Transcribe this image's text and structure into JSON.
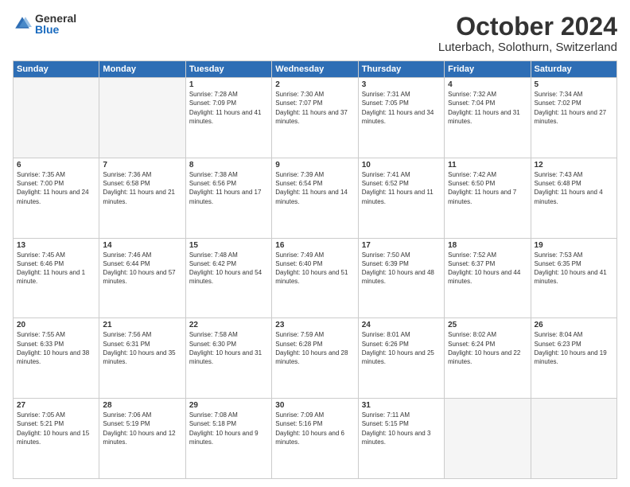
{
  "logo": {
    "general": "General",
    "blue": "Blue"
  },
  "title": "October 2024",
  "location": "Luterbach, Solothurn, Switzerland",
  "headers": [
    "Sunday",
    "Monday",
    "Tuesday",
    "Wednesday",
    "Thursday",
    "Friday",
    "Saturday"
  ],
  "weeks": [
    [
      {
        "day": "",
        "info": ""
      },
      {
        "day": "",
        "info": ""
      },
      {
        "day": "1",
        "sunrise": "Sunrise: 7:28 AM",
        "sunset": "Sunset: 7:09 PM",
        "daylight": "Daylight: 11 hours and 41 minutes."
      },
      {
        "day": "2",
        "sunrise": "Sunrise: 7:30 AM",
        "sunset": "Sunset: 7:07 PM",
        "daylight": "Daylight: 11 hours and 37 minutes."
      },
      {
        "day": "3",
        "sunrise": "Sunrise: 7:31 AM",
        "sunset": "Sunset: 7:05 PM",
        "daylight": "Daylight: 11 hours and 34 minutes."
      },
      {
        "day": "4",
        "sunrise": "Sunrise: 7:32 AM",
        "sunset": "Sunset: 7:04 PM",
        "daylight": "Daylight: 11 hours and 31 minutes."
      },
      {
        "day": "5",
        "sunrise": "Sunrise: 7:34 AM",
        "sunset": "Sunset: 7:02 PM",
        "daylight": "Daylight: 11 hours and 27 minutes."
      }
    ],
    [
      {
        "day": "6",
        "sunrise": "Sunrise: 7:35 AM",
        "sunset": "Sunset: 7:00 PM",
        "daylight": "Daylight: 11 hours and 24 minutes."
      },
      {
        "day": "7",
        "sunrise": "Sunrise: 7:36 AM",
        "sunset": "Sunset: 6:58 PM",
        "daylight": "Daylight: 11 hours and 21 minutes."
      },
      {
        "day": "8",
        "sunrise": "Sunrise: 7:38 AM",
        "sunset": "Sunset: 6:56 PM",
        "daylight": "Daylight: 11 hours and 17 minutes."
      },
      {
        "day": "9",
        "sunrise": "Sunrise: 7:39 AM",
        "sunset": "Sunset: 6:54 PM",
        "daylight": "Daylight: 11 hours and 14 minutes."
      },
      {
        "day": "10",
        "sunrise": "Sunrise: 7:41 AM",
        "sunset": "Sunset: 6:52 PM",
        "daylight": "Daylight: 11 hours and 11 minutes."
      },
      {
        "day": "11",
        "sunrise": "Sunrise: 7:42 AM",
        "sunset": "Sunset: 6:50 PM",
        "daylight": "Daylight: 11 hours and 7 minutes."
      },
      {
        "day": "12",
        "sunrise": "Sunrise: 7:43 AM",
        "sunset": "Sunset: 6:48 PM",
        "daylight": "Daylight: 11 hours and 4 minutes."
      }
    ],
    [
      {
        "day": "13",
        "sunrise": "Sunrise: 7:45 AM",
        "sunset": "Sunset: 6:46 PM",
        "daylight": "Daylight: 11 hours and 1 minute."
      },
      {
        "day": "14",
        "sunrise": "Sunrise: 7:46 AM",
        "sunset": "Sunset: 6:44 PM",
        "daylight": "Daylight: 10 hours and 57 minutes."
      },
      {
        "day": "15",
        "sunrise": "Sunrise: 7:48 AM",
        "sunset": "Sunset: 6:42 PM",
        "daylight": "Daylight: 10 hours and 54 minutes."
      },
      {
        "day": "16",
        "sunrise": "Sunrise: 7:49 AM",
        "sunset": "Sunset: 6:40 PM",
        "daylight": "Daylight: 10 hours and 51 minutes."
      },
      {
        "day": "17",
        "sunrise": "Sunrise: 7:50 AM",
        "sunset": "Sunset: 6:39 PM",
        "daylight": "Daylight: 10 hours and 48 minutes."
      },
      {
        "day": "18",
        "sunrise": "Sunrise: 7:52 AM",
        "sunset": "Sunset: 6:37 PM",
        "daylight": "Daylight: 10 hours and 44 minutes."
      },
      {
        "day": "19",
        "sunrise": "Sunrise: 7:53 AM",
        "sunset": "Sunset: 6:35 PM",
        "daylight": "Daylight: 10 hours and 41 minutes."
      }
    ],
    [
      {
        "day": "20",
        "sunrise": "Sunrise: 7:55 AM",
        "sunset": "Sunset: 6:33 PM",
        "daylight": "Daylight: 10 hours and 38 minutes."
      },
      {
        "day": "21",
        "sunrise": "Sunrise: 7:56 AM",
        "sunset": "Sunset: 6:31 PM",
        "daylight": "Daylight: 10 hours and 35 minutes."
      },
      {
        "day": "22",
        "sunrise": "Sunrise: 7:58 AM",
        "sunset": "Sunset: 6:30 PM",
        "daylight": "Daylight: 10 hours and 31 minutes."
      },
      {
        "day": "23",
        "sunrise": "Sunrise: 7:59 AM",
        "sunset": "Sunset: 6:28 PM",
        "daylight": "Daylight: 10 hours and 28 minutes."
      },
      {
        "day": "24",
        "sunrise": "Sunrise: 8:01 AM",
        "sunset": "Sunset: 6:26 PM",
        "daylight": "Daylight: 10 hours and 25 minutes."
      },
      {
        "day": "25",
        "sunrise": "Sunrise: 8:02 AM",
        "sunset": "Sunset: 6:24 PM",
        "daylight": "Daylight: 10 hours and 22 minutes."
      },
      {
        "day": "26",
        "sunrise": "Sunrise: 8:04 AM",
        "sunset": "Sunset: 6:23 PM",
        "daylight": "Daylight: 10 hours and 19 minutes."
      }
    ],
    [
      {
        "day": "27",
        "sunrise": "Sunrise: 7:05 AM",
        "sunset": "Sunset: 5:21 PM",
        "daylight": "Daylight: 10 hours and 15 minutes."
      },
      {
        "day": "28",
        "sunrise": "Sunrise: 7:06 AM",
        "sunset": "Sunset: 5:19 PM",
        "daylight": "Daylight: 10 hours and 12 minutes."
      },
      {
        "day": "29",
        "sunrise": "Sunrise: 7:08 AM",
        "sunset": "Sunset: 5:18 PM",
        "daylight": "Daylight: 10 hours and 9 minutes."
      },
      {
        "day": "30",
        "sunrise": "Sunrise: 7:09 AM",
        "sunset": "Sunset: 5:16 PM",
        "daylight": "Daylight: 10 hours and 6 minutes."
      },
      {
        "day": "31",
        "sunrise": "Sunrise: 7:11 AM",
        "sunset": "Sunset: 5:15 PM",
        "daylight": "Daylight: 10 hours and 3 minutes."
      },
      {
        "day": "",
        "info": ""
      },
      {
        "day": "",
        "info": ""
      }
    ]
  ]
}
